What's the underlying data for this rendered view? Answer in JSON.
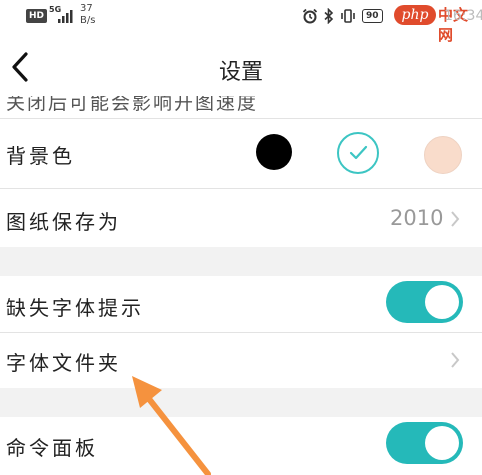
{
  "status_bar": {
    "hd_badge": "HD",
    "network_type": "5G",
    "speed_value": "37",
    "speed_unit": "B/s",
    "battery": "90",
    "time": "16:34",
    "icons": [
      "alarm-icon",
      "bluetooth-icon",
      "vibrate-icon",
      "battery-icon"
    ]
  },
  "watermark": {
    "logo": "php",
    "text": "中文网"
  },
  "header": {
    "title": "设置",
    "back_icon": "chevron-left-icon"
  },
  "settings": {
    "clipped_row_label": "关闭后可能会影响开图速度",
    "background_color": {
      "label": "背景色",
      "options": [
        {
          "name": "black",
          "color": "#000000",
          "selected": false
        },
        {
          "name": "white",
          "color": "#ffffff",
          "selected": true
        },
        {
          "name": "peach",
          "color": "#f9dccb",
          "selected": false
        }
      ]
    },
    "save_drawing_as": {
      "label": "图纸保存为",
      "value": "2010"
    },
    "missing_font_hint": {
      "label": "缺失字体提示",
      "enabled": true
    },
    "font_folder": {
      "label": "字体文件夹"
    },
    "command_panel": {
      "label": "命令面板",
      "enabled": true
    }
  },
  "colors": {
    "accent": "#25b9b9",
    "annotation_arrow": "#f5923e",
    "watermark": "#e04b2c"
  }
}
